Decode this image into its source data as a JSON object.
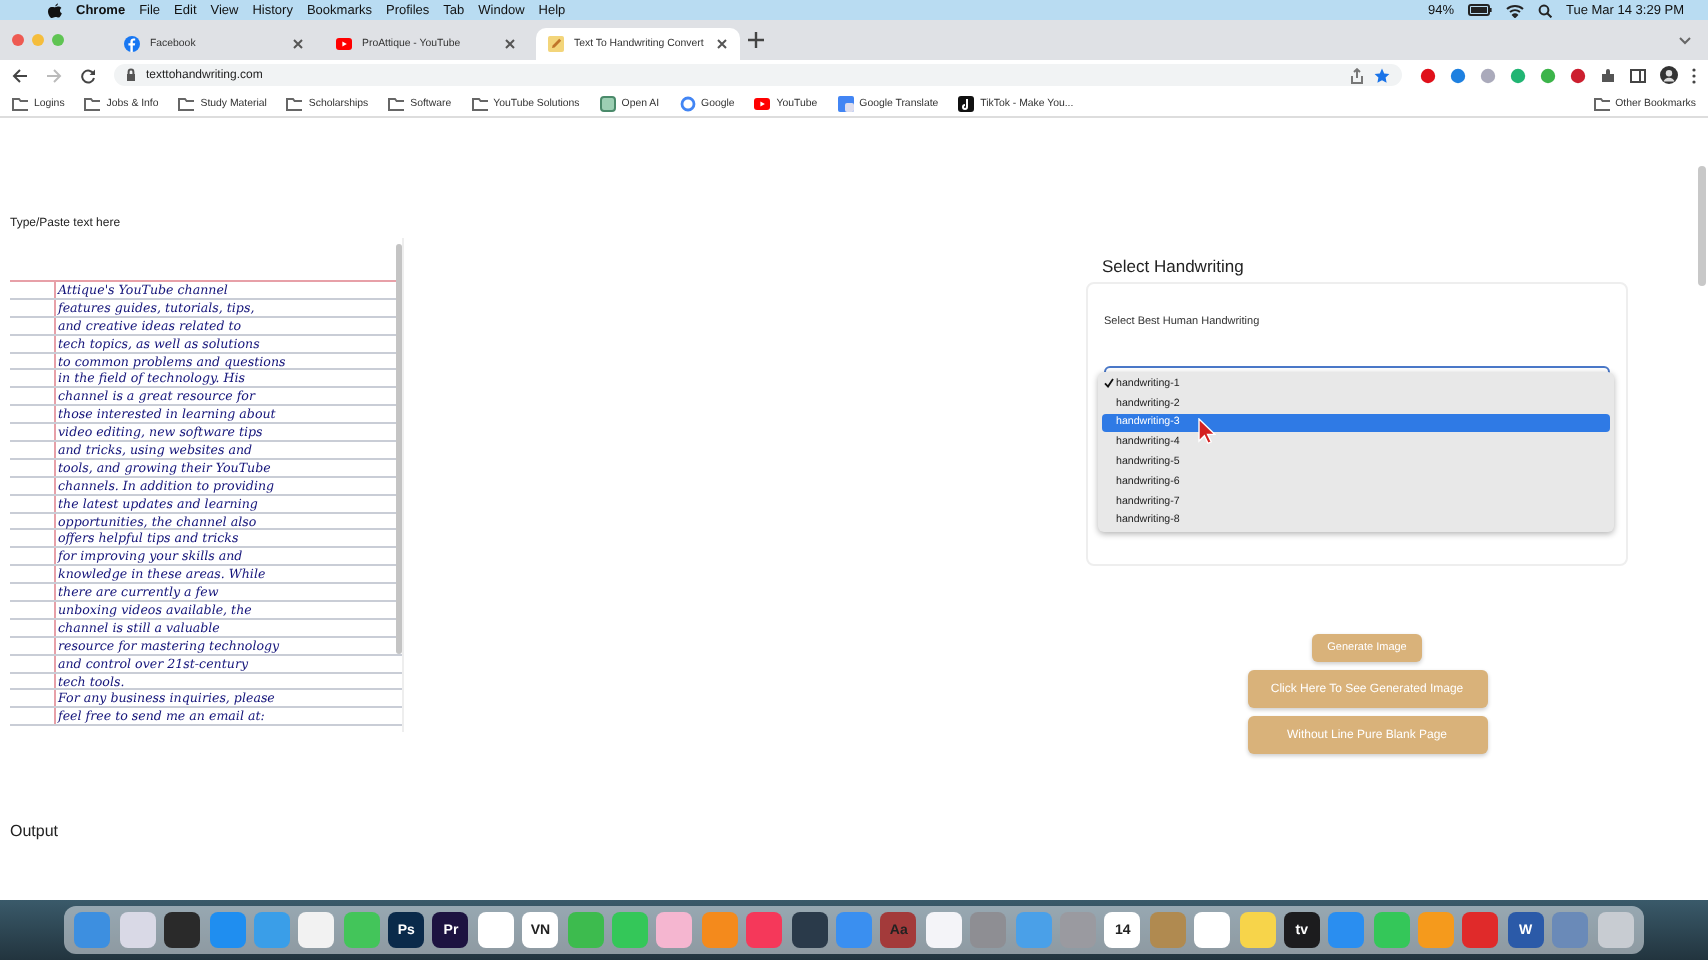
{
  "menu_bar": {
    "items": [
      {
        "label": "Chrome",
        "kind": "app"
      },
      {
        "label": "File",
        "kind": "menu"
      },
      {
        "label": "Edit",
        "kind": "menu"
      },
      {
        "label": "View",
        "kind": "menu"
      },
      {
        "label": "History",
        "kind": "menu"
      },
      {
        "label": "Bookmarks",
        "kind": "menu"
      },
      {
        "label": "Profiles",
        "kind": "menu"
      },
      {
        "label": "Tab",
        "kind": "menu"
      },
      {
        "label": "Window",
        "kind": "menu"
      },
      {
        "label": "Help",
        "kind": "menu"
      }
    ],
    "battery": "94%",
    "clock": "Tue Mar 14  3:29 PM"
  },
  "tabs": [
    {
      "title": "Facebook",
      "kind": "facebook",
      "selected": false
    },
    {
      "title": "ProAttique - YouTube",
      "kind": "youtube",
      "selected": false
    },
    {
      "title": "Text To Handwriting Convert",
      "kind": "pencil",
      "selected": true
    }
  ],
  "address_bar": {
    "url": "texttohandwriting.com"
  },
  "bookmarks": [
    {
      "label": "Logins",
      "kind": "folder"
    },
    {
      "label": "Jobs & Info",
      "kind": "folder"
    },
    {
      "label": "Study Material",
      "kind": "folder"
    },
    {
      "label": "Scholarships",
      "kind": "folder"
    },
    {
      "label": "Software",
      "kind": "folder"
    },
    {
      "label": "YouTube Solutions",
      "kind": "folder"
    },
    {
      "label": "Open AI",
      "kind": "openai"
    },
    {
      "label": "Google",
      "kind": "google"
    },
    {
      "label": "YouTube",
      "kind": "youtube"
    },
    {
      "label": "Google Translate",
      "kind": "translate"
    },
    {
      "label": "TikTok - Make You...",
      "kind": "tiktok"
    }
  ],
  "other_bookmarks": "Other Bookmarks",
  "page": {
    "input_label": "Type/Paste text here",
    "paper_lines": [
      "Attique's YouTube channel",
      "features guides, tutorials, tips,",
      "and creative ideas related to",
      "tech topics, as well as solutions",
      "to common problems and questions",
      "in the field of technology. His",
      "channel is a great resource for",
      "those interested in learning about",
      "video editing, new software tips",
      "and tricks, using websites and",
      "tools, and growing their YouTube",
      "channels. In addition to providing",
      "the latest updates and learning",
      "opportunities, the channel also",
      "offers helpful tips and tricks",
      "for improving your skills and",
      "knowledge in these areas. While",
      "there are currently a few",
      "unboxing videos available, the",
      "channel is still a valuable",
      "resource for mastering technology",
      "and control over 21st-century",
      "tech tools.",
      "For any business inquiries, please",
      "feel free to send me an email at:"
    ],
    "section_title": "Select Handwriting",
    "field_label": "Select Best Human Handwriting",
    "options": [
      {
        "label": "handwriting-1",
        "checked": true,
        "selected": false
      },
      {
        "label": "handwriting-2",
        "checked": false,
        "selected": false
      },
      {
        "label": "handwriting-3",
        "checked": false,
        "selected": true
      },
      {
        "label": "handwriting-4",
        "checked": false,
        "selected": false
      },
      {
        "label": "handwriting-5",
        "checked": false,
        "selected": false
      },
      {
        "label": "handwriting-6",
        "checked": false,
        "selected": false
      },
      {
        "label": "handwriting-7",
        "checked": false,
        "selected": false
      },
      {
        "label": "handwriting-8",
        "checked": false,
        "selected": false
      }
    ],
    "buttons": [
      {
        "label": "Generate Image",
        "kind": "small"
      },
      {
        "label": "Click Here To See Generated Image",
        "kind": "large"
      },
      {
        "label": "Without Line Pure Blank Page",
        "kind": "large"
      }
    ],
    "output_label": "Output"
  },
  "dock": [
    {
      "color": "#3d8fe0"
    },
    {
      "color": "#d9d9e6"
    },
    {
      "color": "#2a2a2a"
    },
    {
      "color": "#1f8ef0"
    },
    {
      "color": "#3a9ee8"
    },
    {
      "color": "#f2f2f2"
    },
    {
      "color": "#43c55a"
    },
    {
      "color": "#0a2a4a",
      "label": "Ps"
    },
    {
      "color": "#1d1340",
      "label": "Pr"
    },
    {
      "color": "#ffffff"
    },
    {
      "color": "#ffffff",
      "label": "VN"
    },
    {
      "color": "#3dbb4e"
    },
    {
      "color": "#34c759"
    },
    {
      "color": "#f5b6d0"
    },
    {
      "color": "#f48a1c"
    },
    {
      "color": "#f5385a"
    },
    {
      "color": "#2a3a4a"
    },
    {
      "color": "#3a8ff0"
    },
    {
      "color": "#a33a3a",
      "label": "Aa"
    },
    {
      "color": "#f4f4f8"
    },
    {
      "color": "#8e8e93"
    },
    {
      "color": "#4aa0e8"
    },
    {
      "color": "#9a9aa0"
    },
    {
      "color": "#ffffff",
      "label": "14"
    },
    {
      "color": "#b08a50"
    },
    {
      "color": "#ffffff"
    },
    {
      "color": "#f7d44a"
    },
    {
      "color": "#1c1c1e",
      "label": "tv"
    },
    {
      "color": "#2a8ef0"
    },
    {
      "color": "#34c759"
    },
    {
      "color": "#f59a1c"
    },
    {
      "color": "#e02a2a"
    },
    {
      "color": "#2b5aa8",
      "label": "W"
    },
    {
      "color": "#6a8ab8"
    },
    {
      "color": "#c8ccd2"
    }
  ]
}
